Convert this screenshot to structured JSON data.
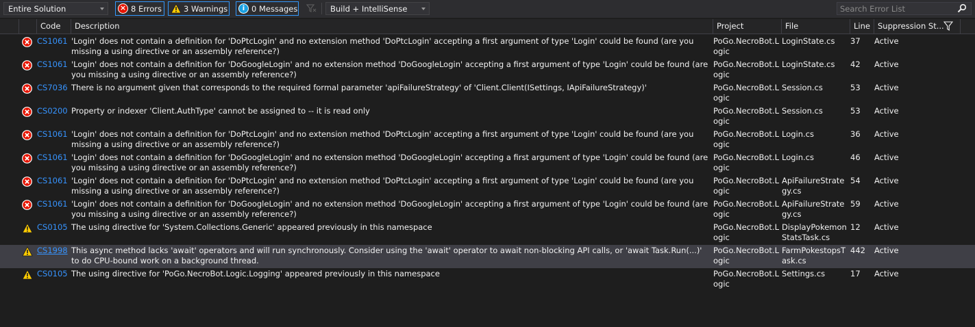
{
  "toolbar": {
    "scope_value": "Entire Solution",
    "errors_label": "8 Errors",
    "warnings_label": "3 Warnings",
    "messages_label": "0 Messages",
    "build_value": "Build + IntelliSense",
    "search_placeholder": "Search Error List"
  },
  "columns": {
    "code": "Code",
    "description": "Description",
    "project": "Project",
    "file": "File",
    "line": "Line",
    "suppression": "Suppression St..."
  },
  "rows": [
    {
      "severity": "error",
      "code": "CS1061",
      "description": "'Login' does not contain a definition for 'DoPtcLogin' and no extension method 'DoPtcLogin' accepting a first argument of type 'Login' could be found (are you missing a using directive or an assembly reference?)",
      "project": "PoGo.NecroBot.Logic",
      "file": "LoginState.cs",
      "line": "37",
      "suppression": "Active"
    },
    {
      "severity": "error",
      "code": "CS1061",
      "description": "'Login' does not contain a definition for 'DoGoogleLogin' and no extension method 'DoGoogleLogin' accepting a first argument of type 'Login' could be found (are you missing a using directive or an assembly reference?)",
      "project": "PoGo.NecroBot.Logic",
      "file": "LoginState.cs",
      "line": "42",
      "suppression": "Active"
    },
    {
      "severity": "error",
      "code": "CS7036",
      "description": "There is no argument given that corresponds to the required formal parameter 'apiFailureStrategy' of 'Client.Client(ISettings, IApiFailureStrategy)'",
      "project": "PoGo.NecroBot.Logic",
      "file": "Session.cs",
      "line": "53",
      "suppression": "Active"
    },
    {
      "severity": "error",
      "code": "CS0200",
      "description": "Property or indexer 'Client.AuthType' cannot be assigned to -- it is read only",
      "project": "PoGo.NecroBot.Logic",
      "file": "Session.cs",
      "line": "53",
      "suppression": "Active"
    },
    {
      "severity": "error",
      "code": "CS1061",
      "description": "'Login' does not contain a definition for 'DoPtcLogin' and no extension method 'DoPtcLogin' accepting a first argument of type 'Login' could be found (are you missing a using directive or an assembly reference?)",
      "project": "PoGo.NecroBot.Logic",
      "file": "Login.cs",
      "line": "36",
      "suppression": "Active"
    },
    {
      "severity": "error",
      "code": "CS1061",
      "description": "'Login' does not contain a definition for 'DoGoogleLogin' and no extension method 'DoGoogleLogin' accepting a first argument of type 'Login' could be found (are you missing a using directive or an assembly reference?)",
      "project": "PoGo.NecroBot.Logic",
      "file": "Login.cs",
      "line": "46",
      "suppression": "Active"
    },
    {
      "severity": "error",
      "code": "CS1061",
      "description": "'Login' does not contain a definition for 'DoPtcLogin' and no extension method 'DoPtcLogin' accepting a first argument of type 'Login' could be found (are you missing a using directive or an assembly reference?)",
      "project": "PoGo.NecroBot.Logic",
      "file": "ApiFailureStrategy.cs",
      "line": "54",
      "suppression": "Active"
    },
    {
      "severity": "error",
      "code": "CS1061",
      "description": "'Login' does not contain a definition for 'DoGoogleLogin' and no extension method 'DoGoogleLogin' accepting a first argument of type 'Login' could be found (are you missing a using directive or an assembly reference?)",
      "project": "PoGo.NecroBot.Logic",
      "file": "ApiFailureStrategy.cs",
      "line": "59",
      "suppression": "Active"
    },
    {
      "severity": "warning",
      "code": "CS0105",
      "description": "The using directive for 'System.Collections.Generic' appeared previously in this namespace",
      "project": "PoGo.NecroBot.Logic",
      "file": "DisplayPokemonStatsTask.cs",
      "line": "12",
      "suppression": "Active"
    },
    {
      "severity": "warning",
      "code": "CS1998",
      "description": "This async method lacks 'await' operators and will run synchronously. Consider using the 'await' operator to await non-blocking API calls, or 'await Task.Run(...)' to do CPU-bound work on a background thread.",
      "project": "PoGo.NecroBot.Logic",
      "file": "FarmPokestopsTask.cs",
      "line": "442",
      "suppression": "Active"
    },
    {
      "severity": "warning",
      "code": "CS0105",
      "description": "The using directive for 'PoGo.NecroBot.Logic.Logging' appeared previously in this namespace",
      "project": "PoGo.NecroBot.Logic",
      "file": "Settings.cs",
      "line": "17",
      "suppression": "Active"
    }
  ]
}
